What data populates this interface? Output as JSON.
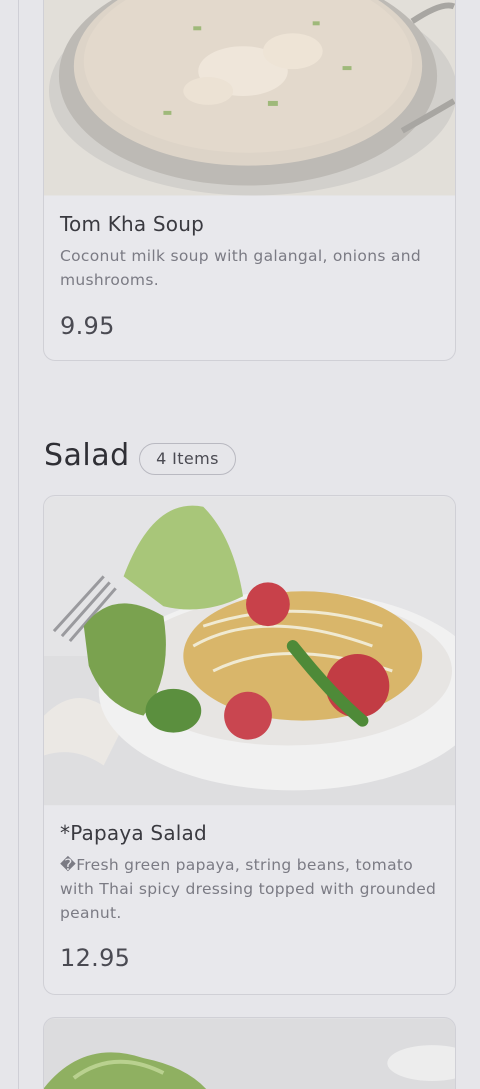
{
  "items": [
    {
      "name": "Tom Kha Soup",
      "description": "Coconut milk soup with galangal, onions and mushrooms.",
      "price": "9.95"
    },
    {
      "name": "*Papaya Salad",
      "description": "�Fresh green papaya, string beans, tomato with Thai spicy dressing topped with grounded peanut.",
      "price": "12.95"
    }
  ],
  "section": {
    "title": "Salad",
    "count_label": "4 Items"
  },
  "colors": {
    "background": "#e6e6ea",
    "card_border": "#d0d0d6",
    "title_text": "#3a3a40",
    "muted_text": "#7b7b84"
  }
}
